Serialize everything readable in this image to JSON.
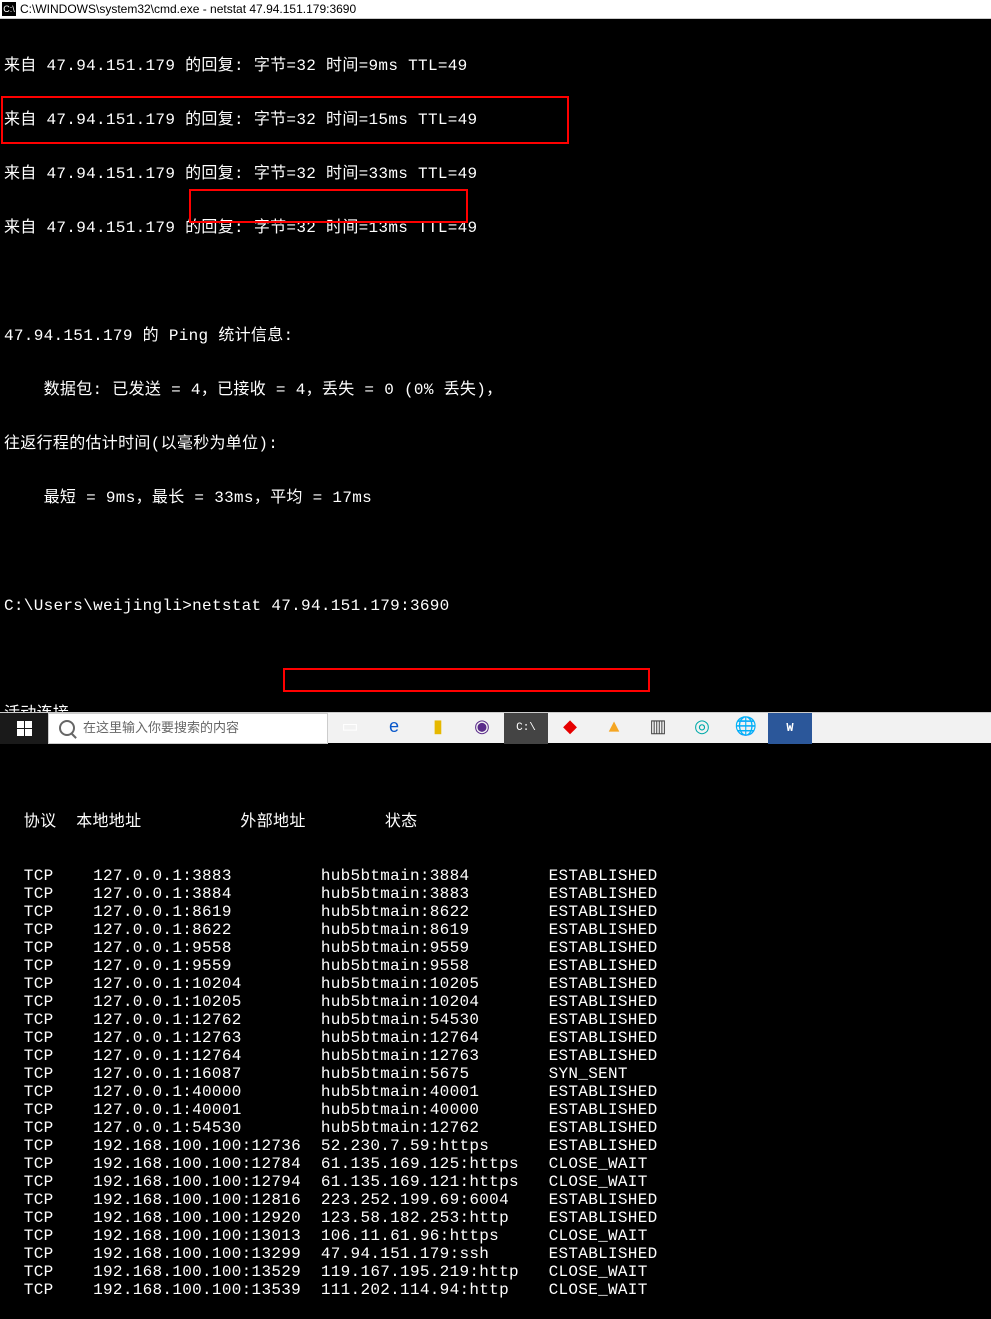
{
  "titlebar": {
    "icon": "C:\\",
    "text": "C:\\WINDOWS\\system32\\cmd.exe - netstat  47.94.151.179:3690"
  },
  "ping_lines": [
    "来自 47.94.151.179 的回复: 字节=32 时间=9ms TTL=49",
    "来自 47.94.151.179 的回复: 字节=32 时间=15ms TTL=49",
    "来自 47.94.151.179 的回复: 字节=32 时间=33ms TTL=49",
    "来自 47.94.151.179 的回复: 字节=32 时间=13ms TTL=49"
  ],
  "stats": {
    "line1": "47.94.151.179 的 Ping 统计信息:",
    "line2": "    数据包: 已发送 = 4，已接收 = 4，丢失 = 0 (0% 丢失)，",
    "line3": "往返行程的估计时间(以毫秒为单位):",
    "line4": "    最短 = 9ms，最长 = 33ms，平均 = 17ms"
  },
  "prompt": {
    "path": "C:\\Users\\weijingli>",
    "cmd": "netstat 47.94.151.179:3690"
  },
  "active_conn_label": "活动连接",
  "headers": "  协议  本地地址          外部地址        状态",
  "connections": [
    {
      "p": "TCP",
      "l": "127.0.0.1:3883",
      "r": "hub5btmain:3884",
      "s": "ESTABLISHED"
    },
    {
      "p": "TCP",
      "l": "127.0.0.1:3884",
      "r": "hub5btmain:3883",
      "s": "ESTABLISHED"
    },
    {
      "p": "TCP",
      "l": "127.0.0.1:8619",
      "r": "hub5btmain:8622",
      "s": "ESTABLISHED"
    },
    {
      "p": "TCP",
      "l": "127.0.0.1:8622",
      "r": "hub5btmain:8619",
      "s": "ESTABLISHED"
    },
    {
      "p": "TCP",
      "l": "127.0.0.1:9558",
      "r": "hub5btmain:9559",
      "s": "ESTABLISHED"
    },
    {
      "p": "TCP",
      "l": "127.0.0.1:9559",
      "r": "hub5btmain:9558",
      "s": "ESTABLISHED"
    },
    {
      "p": "TCP",
      "l": "127.0.0.1:10204",
      "r": "hub5btmain:10205",
      "s": "ESTABLISHED"
    },
    {
      "p": "TCP",
      "l": "127.0.0.1:10205",
      "r": "hub5btmain:10204",
      "s": "ESTABLISHED"
    },
    {
      "p": "TCP",
      "l": "127.0.0.1:12762",
      "r": "hub5btmain:54530",
      "s": "ESTABLISHED"
    },
    {
      "p": "TCP",
      "l": "127.0.0.1:12763",
      "r": "hub5btmain:12764",
      "s": "ESTABLISHED"
    },
    {
      "p": "TCP",
      "l": "127.0.0.1:12764",
      "r": "hub5btmain:12763",
      "s": "ESTABLISHED"
    },
    {
      "p": "TCP",
      "l": "127.0.0.1:16087",
      "r": "hub5btmain:5675",
      "s": "SYN_SENT"
    },
    {
      "p": "TCP",
      "l": "127.0.0.1:40000",
      "r": "hub5btmain:40001",
      "s": "ESTABLISHED"
    },
    {
      "p": "TCP",
      "l": "127.0.0.1:40001",
      "r": "hub5btmain:40000",
      "s": "ESTABLISHED"
    },
    {
      "p": "TCP",
      "l": "127.0.0.1:54530",
      "r": "hub5btmain:12762",
      "s": "ESTABLISHED"
    },
    {
      "p": "TCP",
      "l": "192.168.100.100:12736",
      "r": "52.230.7.59:https",
      "s": "ESTABLISHED"
    },
    {
      "p": "TCP",
      "l": "192.168.100.100:12784",
      "r": "61.135.169.125:https",
      "s": "CLOSE_WAIT"
    },
    {
      "p": "TCP",
      "l": "192.168.100.100:12794",
      "r": "61.135.169.121:https",
      "s": "CLOSE_WAIT"
    },
    {
      "p": "TCP",
      "l": "192.168.100.100:12816",
      "r": "223.252.199.69:6004",
      "s": "ESTABLISHED"
    },
    {
      "p": "TCP",
      "l": "192.168.100.100:12920",
      "r": "123.58.182.253:http",
      "s": "ESTABLISHED"
    },
    {
      "p": "TCP",
      "l": "192.168.100.100:13013",
      "r": "106.11.61.96:https",
      "s": "CLOSE_WAIT"
    },
    {
      "p": "TCP",
      "l": "192.168.100.100:13299",
      "r": "47.94.151.179:ssh",
      "s": "ESTABLISHED"
    },
    {
      "p": "TCP",
      "l": "192.168.100.100:13529",
      "r": "119.167.195.219:http",
      "s": "CLOSE_WAIT"
    },
    {
      "p": "TCP",
      "l": "192.168.100.100:13539",
      "r": "111.202.114.94:http",
      "s": "CLOSE_WAIT"
    }
  ],
  "taskbar": {
    "search_placeholder": "在这里输入你要搜索的内容"
  }
}
